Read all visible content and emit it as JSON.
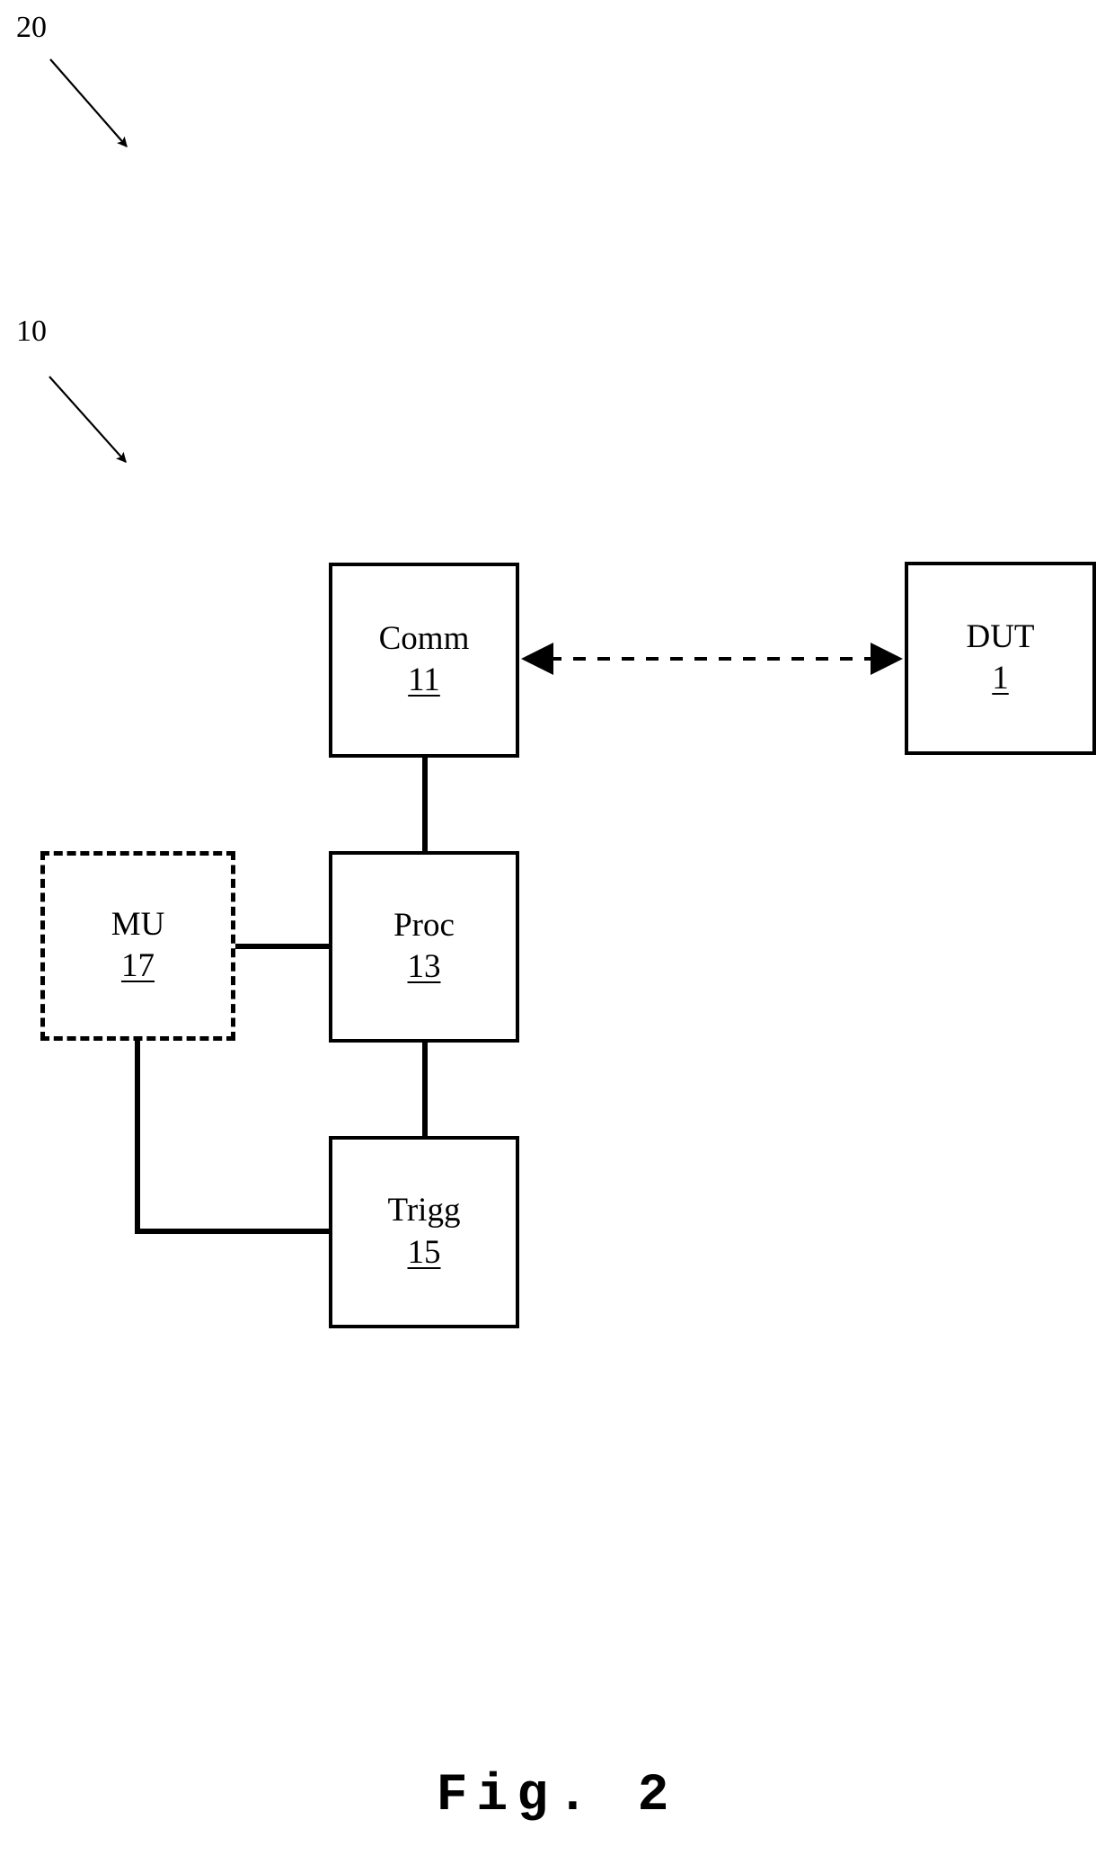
{
  "figure": {
    "caption": "Fig. 2",
    "type": "patent-block-diagram"
  },
  "reference_labels": [
    {
      "id": "ref-20",
      "text": "20",
      "points_to": "system-boundary"
    },
    {
      "id": "ref-10",
      "text": "10",
      "points_to": "test-instrument"
    }
  ],
  "blocks": [
    {
      "id": "comm",
      "label": "Comm",
      "number": "11",
      "style": "solid"
    },
    {
      "id": "dut",
      "label": "DUT",
      "number": "1",
      "style": "solid"
    },
    {
      "id": "proc",
      "label": "Proc",
      "number": "13",
      "style": "solid"
    },
    {
      "id": "mu",
      "label": "MU",
      "number": "17",
      "style": "dashed"
    },
    {
      "id": "trigg",
      "label": "Trigg",
      "number": "15",
      "style": "solid"
    }
  ],
  "connections": [
    {
      "from": "comm",
      "to": "dut",
      "style": "dashed",
      "arrows": "both"
    },
    {
      "from": "comm",
      "to": "proc",
      "style": "solid",
      "arrows": "none"
    },
    {
      "from": "mu",
      "to": "proc",
      "style": "solid",
      "arrows": "none"
    },
    {
      "from": "proc",
      "to": "trigg",
      "style": "solid",
      "arrows": "none"
    },
    {
      "from": "mu",
      "to": "trigg",
      "style": "solid",
      "arrows": "none"
    }
  ],
  "colors": {
    "line": "#000000",
    "background": "#ffffff"
  }
}
